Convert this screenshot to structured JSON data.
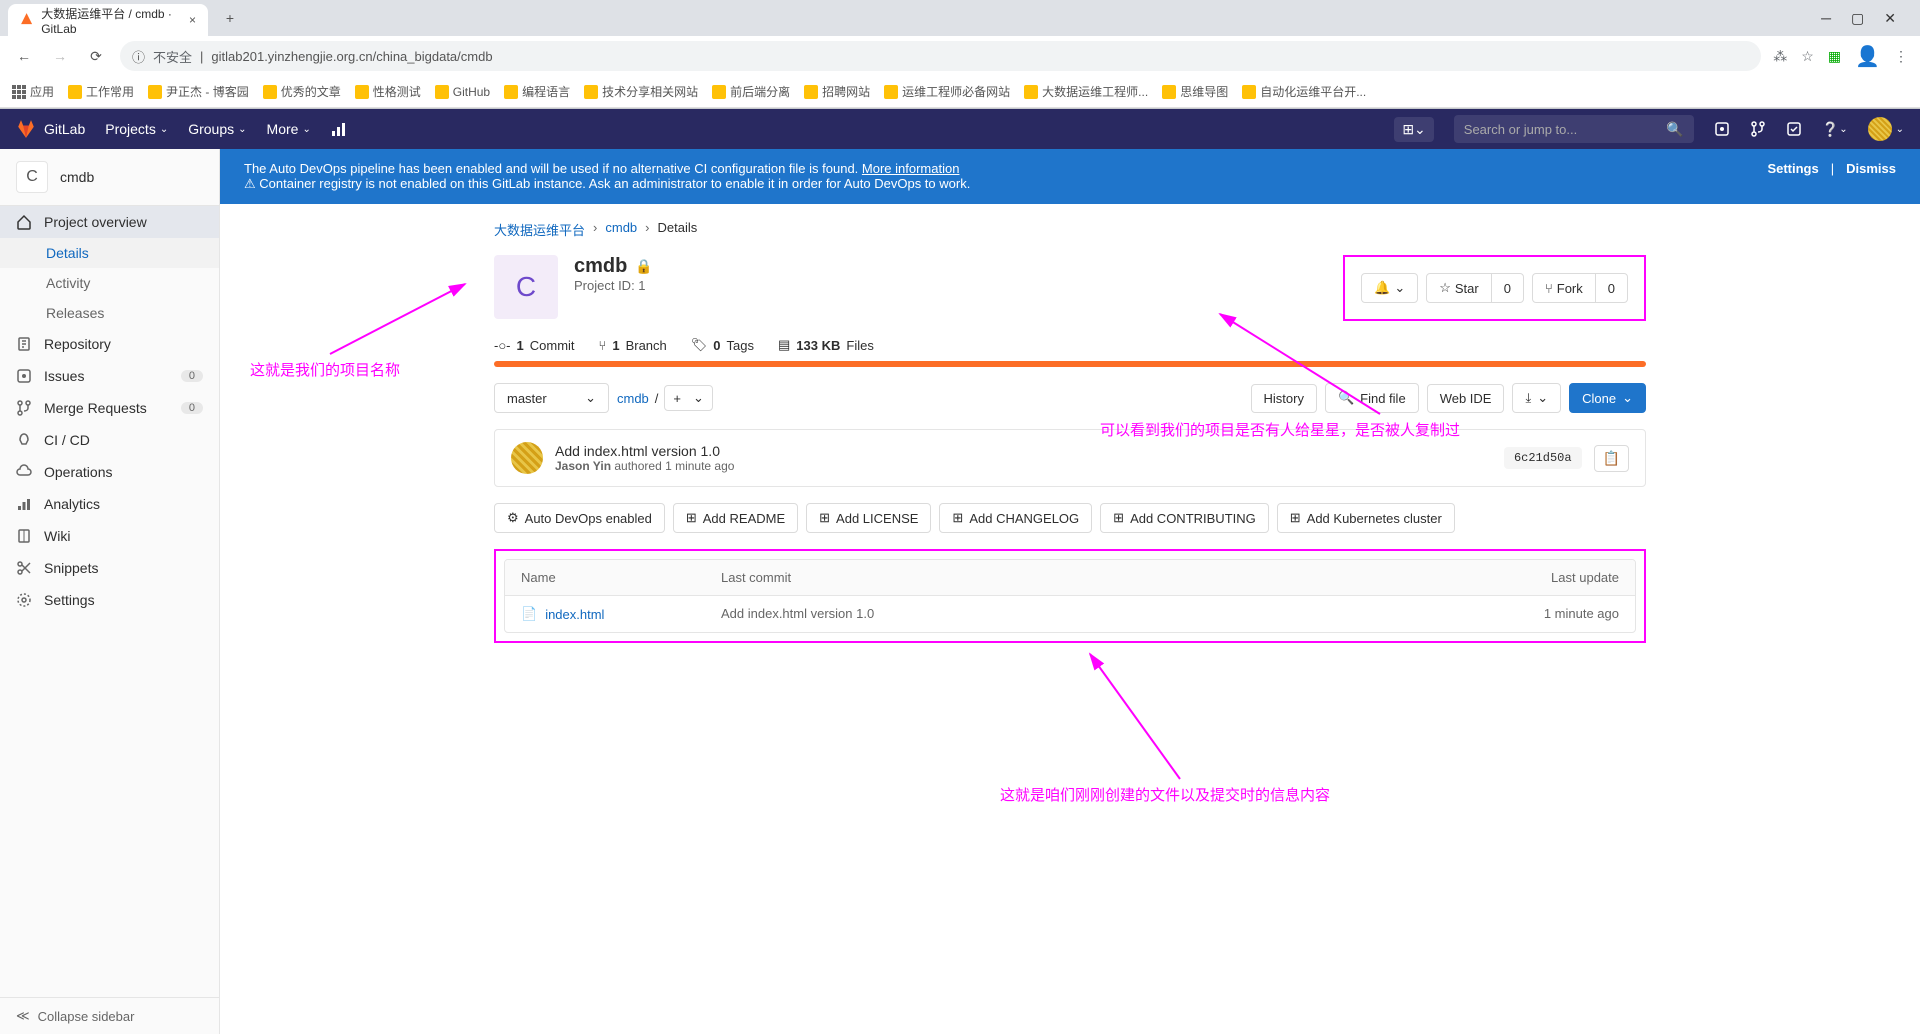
{
  "browser": {
    "tab_title": "大数据运维平台 / cmdb · GitLab",
    "url_insecure": "不安全",
    "url": "gitlab201.yinzhengjie.org.cn/china_bigdata/cmdb",
    "bookmarks": [
      "应用",
      "工作常用",
      "尹正杰 - 博客园",
      "优秀的文章",
      "性格测试",
      "GitHub",
      "编程语言",
      "技术分享相关网站",
      "前后端分离",
      "招聘网站",
      "运维工程师必备网站",
      "大数据运维工程师...",
      "思维导图",
      "自动化运维平台开..."
    ]
  },
  "nav": {
    "brand": "GitLab",
    "projects": "Projects",
    "groups": "Groups",
    "more": "More",
    "search_placeholder": "Search or jump to..."
  },
  "banner": {
    "line1a": "The Auto DevOps pipeline has been enabled and will be used if no alternative CI configuration file is found. ",
    "line1b": "More information",
    "line2": "Container registry is not enabled on this GitLab instance. Ask an administrator to enable it in order for Auto DevOps to work.",
    "settings": "Settings",
    "dismiss": "Dismiss"
  },
  "sidebar": {
    "project_letter": "C",
    "project_name": "cmdb",
    "items": {
      "overview": "Project overview",
      "details": "Details",
      "activity": "Activity",
      "releases": "Releases",
      "repository": "Repository",
      "issues": "Issues",
      "issues_count": "0",
      "merge": "Merge Requests",
      "merge_count": "0",
      "cicd": "CI / CD",
      "operations": "Operations",
      "analytics": "Analytics",
      "wiki": "Wiki",
      "snippets": "Snippets",
      "settings": "Settings"
    },
    "collapse": "Collapse sidebar"
  },
  "breadcrumb": {
    "group": "大数据运维平台",
    "project": "cmdb",
    "page": "Details"
  },
  "project": {
    "avatar_letter": "C",
    "name": "cmdb",
    "subtitle": "Project ID: 1",
    "star": "Star",
    "star_count": "0",
    "fork": "Fork",
    "fork_count": "0"
  },
  "stats": {
    "commits_n": "1",
    "commits": "Commit",
    "branches_n": "1",
    "branches": "Branch",
    "tags_n": "0",
    "tags": "Tags",
    "size": "133 KB",
    "files": "Files"
  },
  "controls": {
    "branch": "master",
    "path": "cmdb",
    "history": "History",
    "find": "Find file",
    "webide": "Web IDE",
    "clone": "Clone"
  },
  "commit": {
    "title": "Add index.html version 1.0",
    "author": "Jason Yin",
    "meta": " authored 1 minute ago",
    "sha": "6c21d50a"
  },
  "addfiles": {
    "devops": "Auto DevOps enabled",
    "readme": "Add README",
    "license": "Add LICENSE",
    "changelog": "Add CHANGELOG",
    "contributing": "Add CONTRIBUTING",
    "k8s": "Add Kubernetes cluster"
  },
  "filetable": {
    "h1": "Name",
    "h2": "Last commit",
    "h3": "Last update",
    "rows": [
      {
        "name": "index.html",
        "commit": "Add index.html version 1.0",
        "update": "1 minute ago"
      }
    ]
  },
  "annotations": {
    "a1": "这就是我们的项目名称",
    "a2": "可以看到我们的项目是否有人给星星，是否被人复制过",
    "a3": "这就是咱们刚刚创建的文件以及提交时的信息内容"
  }
}
